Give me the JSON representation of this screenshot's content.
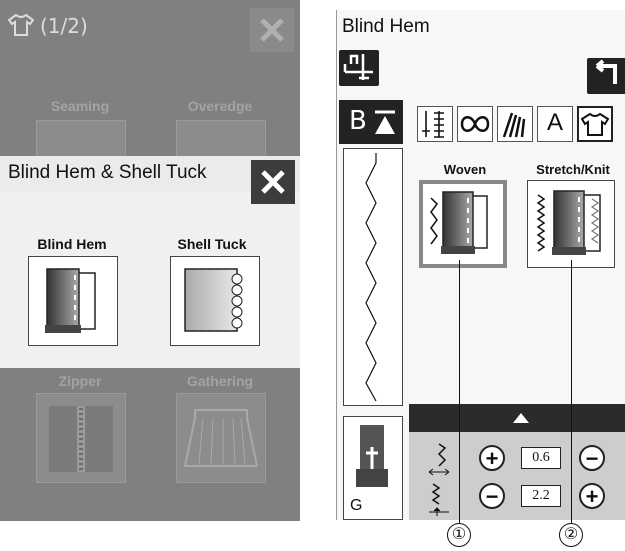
{
  "left_screen": {
    "page_indicator": "(1/2)",
    "background_categories": [
      {
        "label": "Seaming"
      },
      {
        "label": "Overedge"
      },
      {
        "label": "Zipper"
      },
      {
        "label": "Gathering"
      }
    ],
    "modal": {
      "title": "Blind Hem & Shell Tuck",
      "items": [
        {
          "label": "Blind Hem"
        },
        {
          "label": "Shell Tuck"
        }
      ]
    }
  },
  "right_screen": {
    "title": "Blind Hem",
    "stitch_panel": {
      "header_letter": "B",
      "presser_foot_letter": "G"
    },
    "tabs": [
      {
        "icon": "straight-stitch-icon"
      },
      {
        "icon": "decorative-stitch-icon"
      },
      {
        "icon": "satin-stitch-icon"
      },
      {
        "label": "A"
      },
      {
        "icon": "shirt-icon"
      }
    ],
    "options": [
      {
        "label": "Woven"
      },
      {
        "label": "Stretch/Knit"
      }
    ],
    "adjust": {
      "rows": [
        {
          "value": "0.6"
        },
        {
          "value": "2.2"
        }
      ]
    }
  },
  "callouts": [
    "①",
    "②"
  ],
  "colors": {
    "screen_gray": "#808080",
    "dark": "#222222",
    "adjust_panel": "#cdcdcd"
  }
}
